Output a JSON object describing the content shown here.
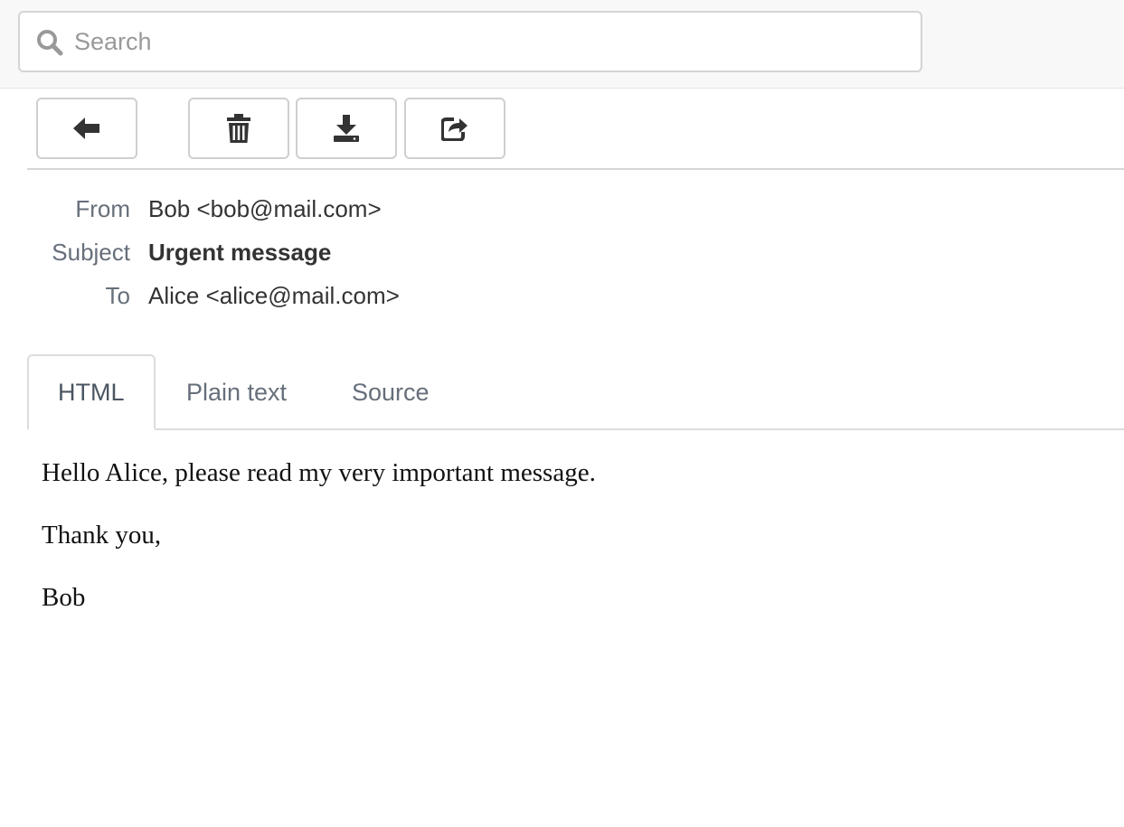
{
  "search": {
    "placeholder": "Search",
    "value": ""
  },
  "toolbar": {
    "buttons": [
      {
        "icon": "back-arrow-icon",
        "label": ""
      },
      {
        "icon": "trash-icon",
        "label": ""
      },
      {
        "icon": "download-icon",
        "label": ""
      },
      {
        "icon": "share-icon",
        "label": ""
      }
    ]
  },
  "headers": {
    "from_label": "From",
    "from_value": "Bob <bob@mail.com>",
    "subject_label": "Subject",
    "subject_value": "Urgent message",
    "to_label": "To",
    "to_value": "Alice <alice@mail.com>"
  },
  "tabs": [
    {
      "label": "HTML",
      "active": true
    },
    {
      "label": "Plain text",
      "active": false
    },
    {
      "label": "Source",
      "active": false
    }
  ],
  "message": {
    "paragraphs": [
      "Hello Alice, please read my very important message.",
      "Thank you,",
      "Bob"
    ]
  },
  "colors": {
    "icon": "#333333",
    "label": "#666f7a",
    "border": "#cfcfcf",
    "topbar_bg": "#f8f8f8"
  }
}
